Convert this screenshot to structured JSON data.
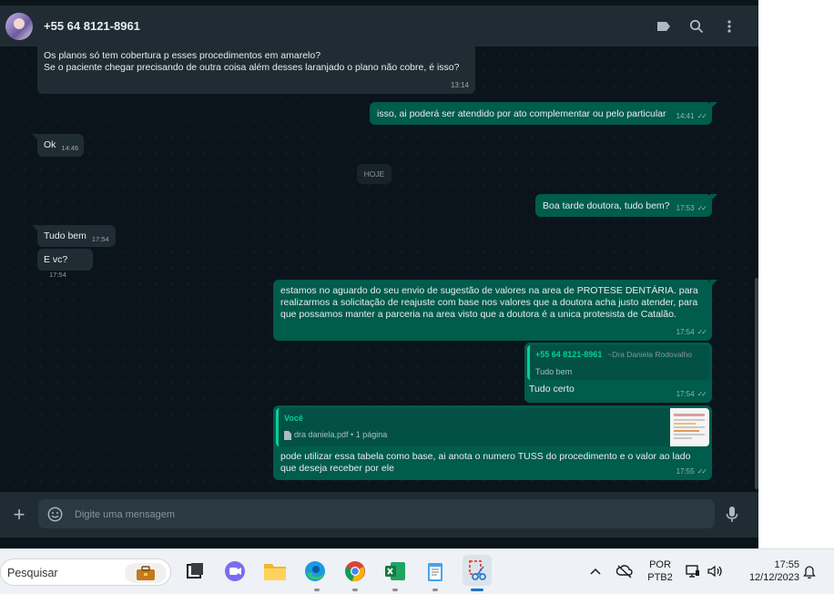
{
  "header": {
    "contact": "+55 64 8121-8961"
  },
  "messages": {
    "m1": {
      "line1": "Os planos só tem cobertura p esses procedimentos em amarelo?",
      "line2": "Se o paciente chegar precisando de outra coisa além desses laranjado o plano não cobre, é isso?",
      "time": "13:14"
    },
    "m2": {
      "text": "isso, ai poderá ser atendido por ato complementar ou pelo particular",
      "time": "14:41"
    },
    "m3": {
      "text": "Ok",
      "time": "14:46"
    },
    "date": "HOJE",
    "m4": {
      "text": "Boa tarde doutora, tudo bem?",
      "time": "17:53"
    },
    "m5": {
      "text": "Tudo bem",
      "time": "17:54"
    },
    "m6": {
      "text": "E vc?",
      "time": "17:54"
    },
    "m7": {
      "line1": "estamos no aguardo do seu envio de sugestão de valores na area de PROTESE DENTÁRIA. para",
      "line2": "realizarmos a solicitação de reajuste com base nos valores que a doutora acha justo atender, para",
      "line3": "que possamos manter a parceria na area visto que a doutora é a unica protesista de Catalão.",
      "time": "17:54"
    },
    "m8": {
      "quote_name": "+55 64 8121-8961",
      "quote_sub": "~Dra Daniela Rodovalho",
      "quote_text": "Tudo bem",
      "text": "Tudo certo",
      "time": "17:54"
    },
    "m9": {
      "quote_name": "Você",
      "file": "dra daniela.pdf • 1 página",
      "line1": "pode utilizar essa tabela como base, ai anota o numero TUSS do procedimento e o valor ao lado",
      "line2": "que deseja receber por ele",
      "time": "17:55"
    }
  },
  "composer": {
    "placeholder": "Digite uma mensagem"
  },
  "taskbar": {
    "search_label": "Pesquisar",
    "lang1": "POR",
    "lang2": "PTB2",
    "clock_time": "17:55",
    "clock_date": "12/12/2023"
  },
  "colors": {
    "incoming": "#202c33",
    "outgoing": "#005c4b",
    "accent": "#06cf9c"
  }
}
